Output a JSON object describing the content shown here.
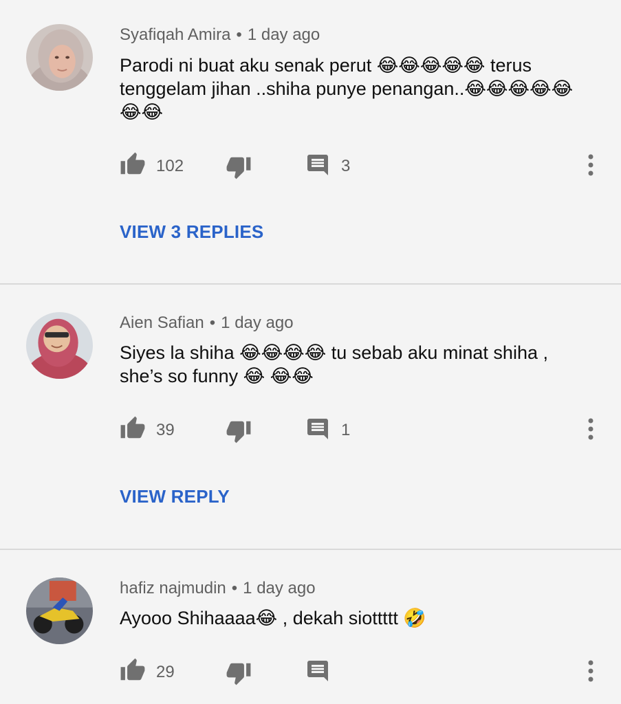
{
  "colors": {
    "background": "#f4f4f4",
    "link": "#2a63c9",
    "meta": "#606060",
    "icon": "#707070"
  },
  "comments": [
    {
      "author": "Syafiqah Amira",
      "separator": "•",
      "time": "1 day ago",
      "text": "Parodi ni buat aku senak perut 😂😂😂😂😂 terus tenggelam jihan ..shiha punye penangan..😂😂😂😂😂😂😂",
      "likes": "102",
      "reply_count": "3",
      "view_replies": "VIEW 3 REPLIES",
      "avatar_icon": "avatar-hijab-woman"
    },
    {
      "author": "Aien Safian",
      "separator": "•",
      "time": "1 day ago",
      "text": "Siyes la shiha 😂😂😂😂 tu sebab aku minat shiha , she’s so funny 😂 😂😂",
      "likes": "39",
      "reply_count": "1",
      "view_replies": "VIEW REPLY",
      "avatar_icon": "avatar-glasses-woman"
    },
    {
      "author": "hafiz najmudin",
      "separator": "•",
      "time": "1 day ago",
      "text": "Ayooo Shihaaaa😂 , dekah siottttt 🤣",
      "likes": "29",
      "reply_count": "",
      "avatar_icon": "avatar-motorcycle"
    }
  ],
  "icons": {
    "like": "thumbs-up-icon",
    "dislike": "thumbs-down-icon",
    "reply": "comment-icon",
    "more": "more-vertical-icon"
  }
}
